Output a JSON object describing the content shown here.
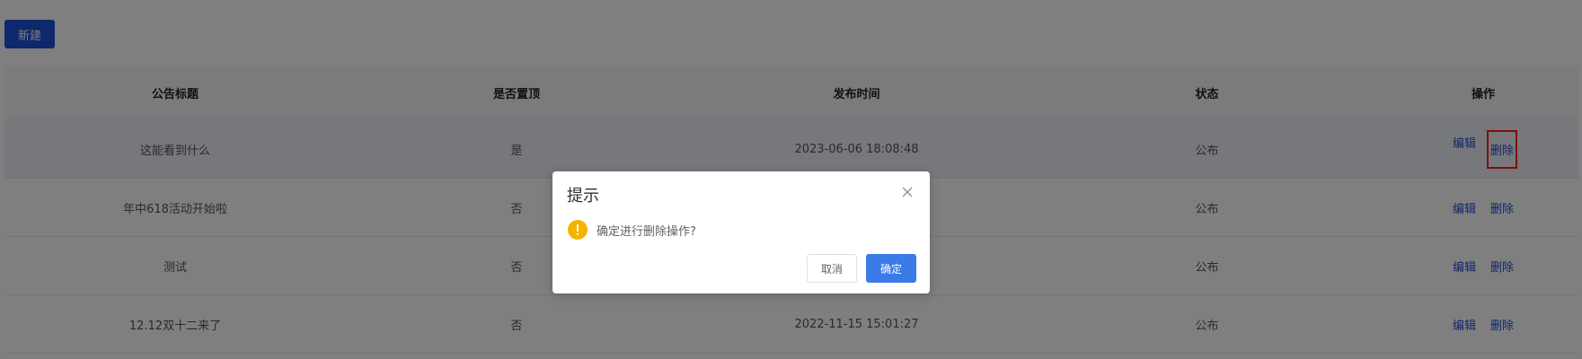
{
  "toolbar": {
    "new_label": "新建"
  },
  "table": {
    "headers": [
      "公告标题",
      "是否置顶",
      "发布时间",
      "状态",
      "操作"
    ],
    "rows": [
      {
        "title": "这能看到什么",
        "pinned": "是",
        "time": "2023-06-06 18:08:48",
        "status": "公布",
        "edit": "编辑",
        "delete": "删除"
      },
      {
        "title": "年中618活动开始啦",
        "pinned": "否",
        "time": "",
        "status": "公布",
        "edit": "编辑",
        "delete": "删除"
      },
      {
        "title": "测试",
        "pinned": "否",
        "time": "",
        "status": "公布",
        "edit": "编辑",
        "delete": "删除"
      },
      {
        "title": "12.12双十二来了",
        "pinned": "否",
        "time": "2022-11-15 15:01:27",
        "status": "公布",
        "edit": "编辑",
        "delete": "删除"
      }
    ]
  },
  "dialog": {
    "title": "提示",
    "message": "确定进行删除操作?",
    "cancel_label": "取消",
    "confirm_label": "确定",
    "warning_icon": "warning-icon",
    "close_icon": "close-icon"
  },
  "colors": {
    "primary": "#1f4ed8",
    "confirm": "#3b7be8",
    "warning": "#f5b400",
    "highlight": "#ff1a1a"
  }
}
